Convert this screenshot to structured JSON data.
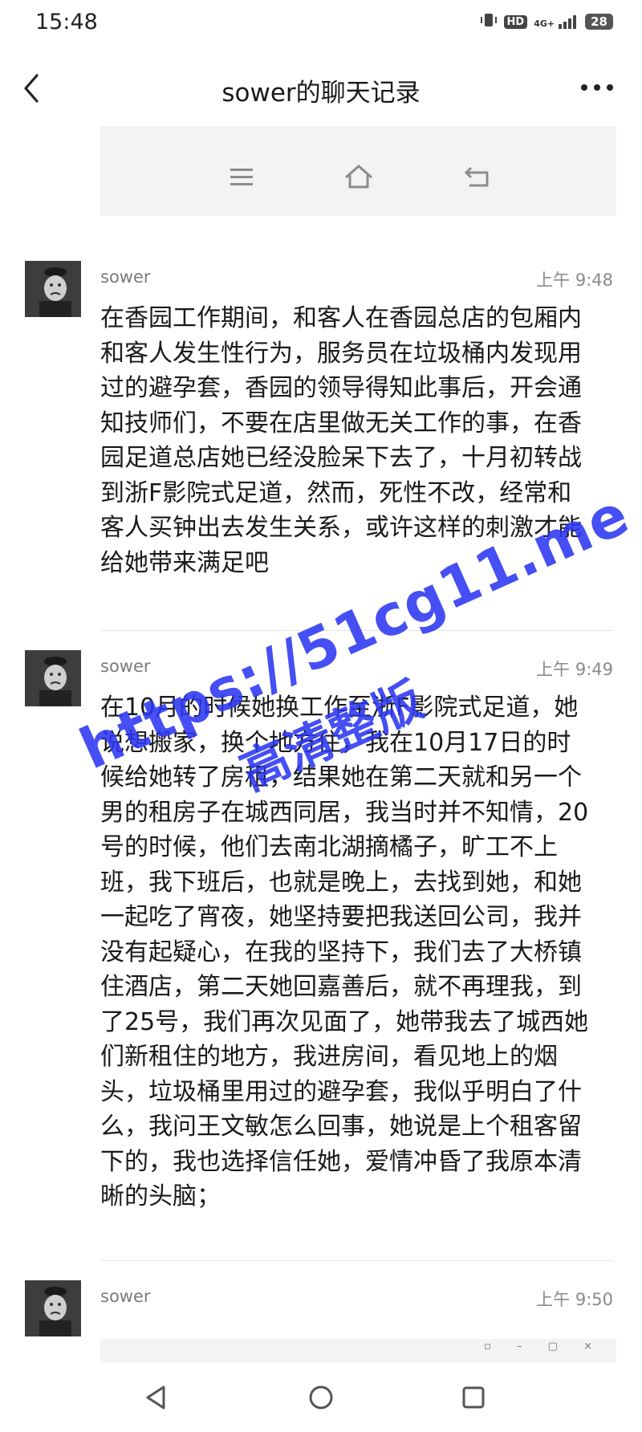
{
  "status_bar": {
    "time": "15:48",
    "network": "4G+",
    "hd": "HD",
    "battery": "28"
  },
  "header": {
    "title": "sower的聊天记录"
  },
  "messages": [
    {
      "sender": "sower",
      "time": "上午 9:48",
      "text": "在香园工作期间，和客人在香园总店的包厢内和客人发生性行为，服务员在垃圾桶内发现用过的避孕套，香园的领导得知此事后，开会通知技师们，不要在店里做无关工作的事，在香园足道总店她已经没脸呆下去了，十月初转战到浙F影院式足道，然而，死性不改，经常和客人买钟出去发生关系，或许这样的刺激才能给她带来满足吧"
    },
    {
      "sender": "sower",
      "time": "上午 9:49",
      "text": "在10月的时候她换工作至浙F影院式足道，她说想搬家，换个地方住，我在10月17日的时候给她转了房租，结果她在第二天就和另一个男的租房子在城西同居，我当时并不知情，20号的时候，他们去南北湖摘橘子，旷工不上班，我下班后，也就是晚上，去找到她，和她一起吃了宵夜，她坚持要把我送回公司，我并没有起疑心，在我的坚持下，我们去了大桥镇住酒店，第二天她回嘉善后，就不再理我，到了25号，我们再次见面了，她带我去了城西她们新租住的地方，我进房间，看见地上的烟头，垃圾桶里用过的避孕套，我似乎明白了什么，我问王文敏怎么回事，她说是上个租客留下的，我也选择信任她，爱情冲昏了我原本清晰的头脑；"
    },
    {
      "sender": "sower",
      "time": "上午 9:50",
      "text": ""
    }
  ],
  "watermark": {
    "url": "https://51cg11.me",
    "tag": "高清整版"
  },
  "icons": {
    "back": "chevron-left-icon",
    "more": "more-dots-icon",
    "nav_back": "triangle-back-icon",
    "nav_home": "circle-home-icon",
    "nav_recent": "square-recent-icon"
  },
  "colors": {
    "watermark": "#2c37f2",
    "secondary_text": "#7a7a7a"
  }
}
